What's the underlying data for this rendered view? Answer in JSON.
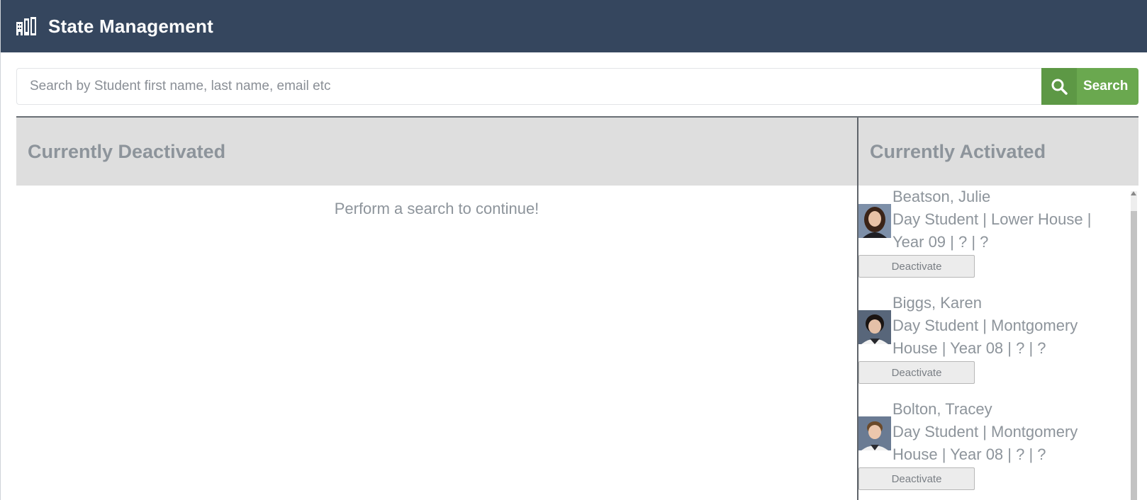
{
  "header": {
    "title": "State Management",
    "logo_icon": "building-icon"
  },
  "search": {
    "placeholder": "Search by Student first name, last name, email etc",
    "value": "",
    "button_label": "Search",
    "button_icon": "search-icon"
  },
  "deactivated": {
    "heading": "Currently Deactivated",
    "empty_message": "Perform a search to continue!"
  },
  "activated": {
    "heading": "Currently Activated",
    "students": [
      {
        "name": "Beatson, Julie",
        "details": "Day Student | Lower House | Year 09 | ? | ?",
        "button_label": "Deactivate"
      },
      {
        "name": "Biggs, Karen",
        "details": "Day Student | Montgomery House | Year 08 | ? | ?",
        "button_label": "Deactivate"
      },
      {
        "name": "Bolton, Tracey",
        "details": "Day Student | Montgomery House | Year 08 | ? | ?",
        "button_label": "Deactivate"
      }
    ]
  },
  "colors": {
    "topbar": "#35465e",
    "search_button": "#6aa84f",
    "panel_header": "#dedede",
    "muted_text": "#8d949b"
  }
}
